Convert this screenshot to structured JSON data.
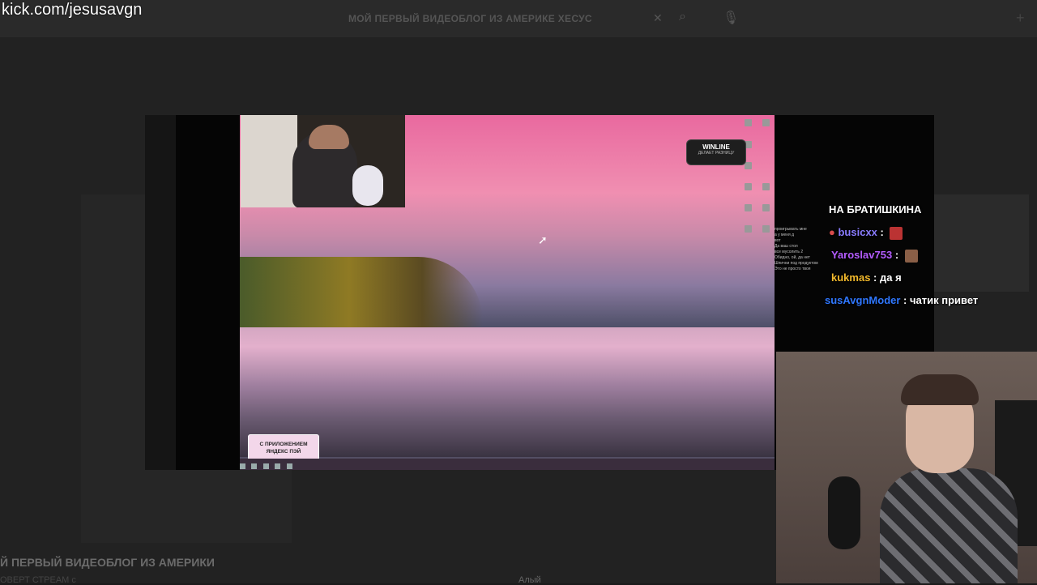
{
  "watermark": "kick.com/jesusavgn",
  "background_page": {
    "tab_title": "МОЙ ПЕРВЫЙ ВИДЕОБЛОГ ИЗ АМЕРИКЕ ХЕСУС",
    "video_title": "Й ПЕРВЫЙ ВИДЕОБЛОГ ИЗ АМЕРИКИ",
    "sub_line": "ОВЕРТ СТРЕАМ с",
    "user_label": "Алый"
  },
  "desktop": {
    "ad_banner": "С ПРИЛОЖЕНИЕМ ЯНДЕКС ПЭЙ",
    "winline_title": "WINLINE",
    "winline_sub": "ДЕЛАЕТ РАЗНИЦУ"
  },
  "chat": {
    "lines": [
      {
        "user": "",
        "text": "НА БРАТИШКИНА",
        "color": "#ffffff"
      },
      {
        "user": "busicxx",
        "text": " : ",
        "color": "#8a7cff"
      },
      {
        "user": "Yaroslav753",
        "text": " : ",
        "color": "#b45cff"
      },
      {
        "user": "kukmas",
        "text": " : да я",
        "color": "#f2b92c"
      },
      {
        "user": "susAvgnModer",
        "text": " : чатик привет",
        "color": "#2f77ff"
      }
    ]
  },
  "mini_chat": [
    "проигрывать мне",
    "а у меня д",
    "вот",
    "Да ваш стол",
    "все мусолить 2",
    "Обидно, ой, да нет",
    "Шпични под продуктом",
    "Это не просто твоя"
  ],
  "icons": {
    "search": "search-icon",
    "mic": "mic-icon",
    "close": "close-icon",
    "plus": "plus-icon",
    "cursor": "cursor-icon"
  }
}
